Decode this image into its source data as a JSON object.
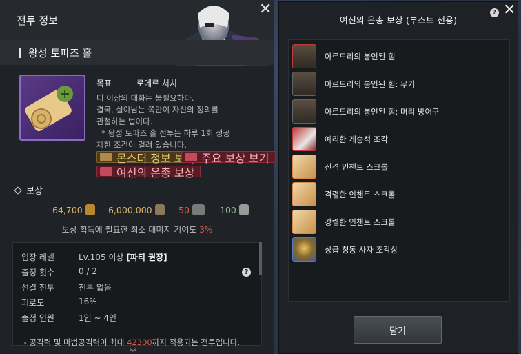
{
  "left": {
    "title": "전투 정보",
    "dungeon_name": "왕성 토파즈 홀",
    "objective_label": "목표",
    "objective_value": "로메르 처치",
    "description": [
      "더 이상의 대화는 불필요하다.",
      "결국, 살아남는 쪽만이 자신의 정의를",
      "관철하는 법이다.",
      "  * 왕성 토파즈 홀 전투는 하루 1회 성공",
      "제한 조건이 걸려 있습니다."
    ],
    "buttons": {
      "monster_info": "몬스터 정보 보기",
      "main_reward": "주요 보상 보기",
      "goddess_reward": "여신의 은총 보상"
    },
    "reward_title": "보상",
    "rewards": {
      "gold": "64,700",
      "exp": "6,000,000",
      "ap": "50",
      "pt": "100"
    },
    "damage_note_prefix": "보상 획득에 필요한 최소 대미지 기여도 ",
    "damage_note_pct": "3%",
    "info": [
      {
        "label": "입장 레벨",
        "value": "Lv.105 이상 ",
        "bold": "[파티 권장]"
      },
      {
        "label": "출정 횟수",
        "value": "0 / 2",
        "bold": ""
      },
      {
        "label": "선결 전투",
        "value": "전투 없음",
        "bold": ""
      },
      {
        "label": "피로도",
        "value": "16%",
        "bold": ""
      },
      {
        "label": "출정 인원",
        "value": "1인 ~ 4인",
        "bold": ""
      }
    ],
    "info_note_prefix": " - 공격력 및 마법공격력이 최대 ",
    "info_note_number": "42300",
    "info_note_suffix": "까지 적용되는 전투입니다."
  },
  "right": {
    "title": "여신의 은총 보상 (부스트 전용)",
    "items": [
      {
        "name": "아르드리의 봉인된 힘",
        "icon": "crown-icon"
      },
      {
        "name": "아르드리의 봉인된 힘: 무기",
        "icon": "crown-weapon-icon"
      },
      {
        "name": "아르드리의 봉인된 힘: 머리 방어구",
        "icon": "crown-helmet-icon"
      },
      {
        "name": "예리한 게승석 조각",
        "icon": "crystal-shard-icon"
      },
      {
        "name": "진격 인챈트 스크롤",
        "icon": "scroll-icon"
      },
      {
        "name": "격렬한 인챈트 스크롤",
        "icon": "scroll-icon"
      },
      {
        "name": "강렬한 인챈트 스크롤",
        "icon": "scroll-icon"
      },
      {
        "name": "상급 청동 사자 조각상",
        "icon": "lion-statue-icon"
      }
    ],
    "close_button": "닫기"
  },
  "colors": {
    "accent_red": "#e2584a",
    "gold": "#e8c87a",
    "panel": "#1f2327"
  }
}
